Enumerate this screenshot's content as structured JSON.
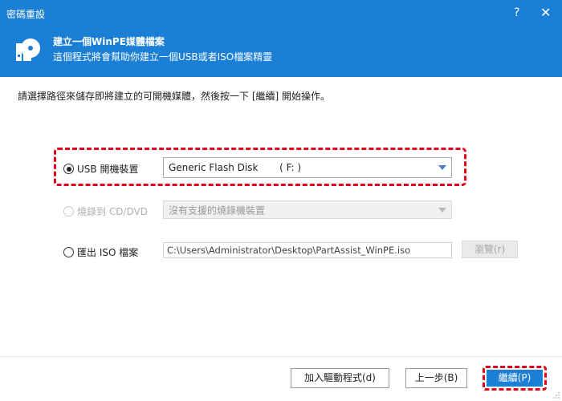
{
  "window": {
    "title": "密碼重設",
    "help_label": "?",
    "close_label": "✕"
  },
  "header": {
    "title": "建立一個WinPE媒體檔案",
    "subtitle": "這個程式將會幫助你建立一個USB或者ISO檔案精靈",
    "icon": "disk-icon"
  },
  "instruction": "請選擇路徑來儲存即將建立的可開機媒體，然後按一下 [繼續] 開始操作。",
  "options": {
    "usb": {
      "label": "USB 開機裝置",
      "selected": true,
      "value": "Generic Flash Disk       ( F: )"
    },
    "cd": {
      "label": "燒錄到 CD/DVD",
      "selected": false,
      "disabled": true,
      "value": "沒有支援的燒錄機裝置"
    },
    "iso": {
      "label": "匯出 ISO 檔案",
      "selected": false,
      "path": "C:\\Users\\Administrator\\Desktop\\PartAssist_WinPE.iso",
      "browse_label": "瀏覽(r)"
    }
  },
  "buttons": {
    "add_driver": "加入驅動程式(d)",
    "back": "上一步(B)",
    "continue": "繼續(P)"
  },
  "colors": {
    "accent": "#1c7fd6",
    "highlight": "#e3001b"
  }
}
